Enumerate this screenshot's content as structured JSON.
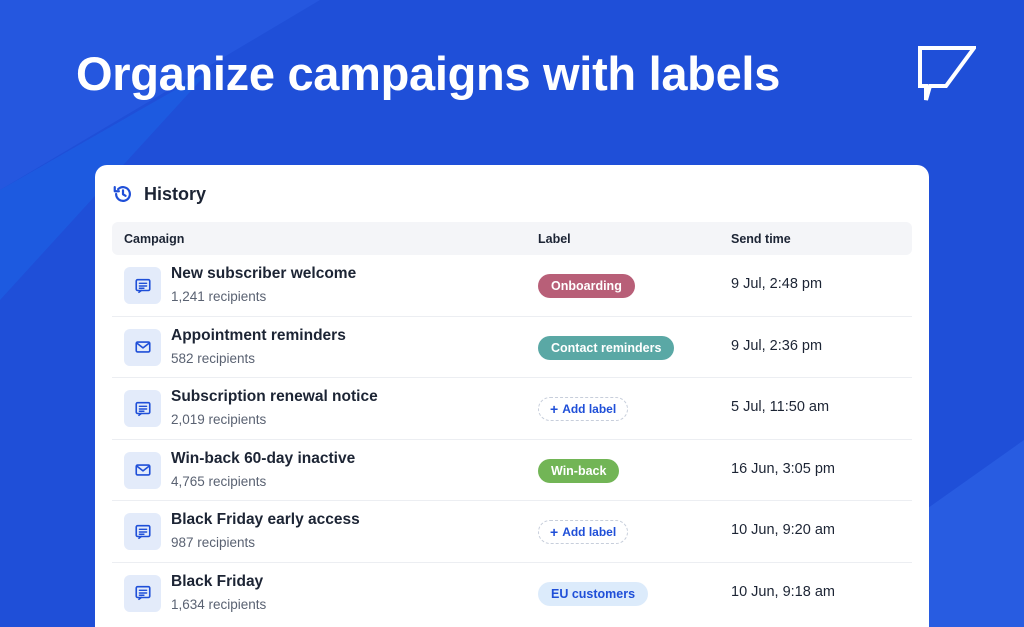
{
  "headline": "Organize campaigns with labels",
  "colors": {
    "background": "#1f4fd8",
    "accent": "#1f4fd8",
    "card": "#ffffff"
  },
  "history": {
    "title": "History",
    "icon": "history-icon",
    "columns": {
      "campaign": "Campaign",
      "label": "Label",
      "send_time": "Send time"
    },
    "rows": [
      {
        "icon": "message-icon",
        "title": "New subscriber welcome",
        "recipients": "1,241 recipients",
        "label": {
          "type": "tag",
          "text": "Onboarding",
          "color": "#b85f78"
        },
        "send_time": "9 Jul, 2:48 pm"
      },
      {
        "icon": "envelope-icon",
        "title": "Appointment reminders",
        "recipients": "582 recipients",
        "label": {
          "type": "tag",
          "text": "Contact reminders",
          "color": "#5aa8a5"
        },
        "send_time": "9 Jul, 2:36 pm"
      },
      {
        "icon": "message-icon",
        "title": "Subscription renewal notice",
        "recipients": "2,019 recipients",
        "label": {
          "type": "add",
          "text": "Add label"
        },
        "send_time": "5 Jul, 11:50 am"
      },
      {
        "icon": "envelope-icon",
        "title": "Win-back 60-day inactive",
        "recipients": "4,765 recipients",
        "label": {
          "type": "tag",
          "text": "Win-back",
          "color": "#72b556"
        },
        "send_time": "16 Jun, 3:05 pm"
      },
      {
        "icon": "message-icon",
        "title": "Black Friday early access",
        "recipients": "987 recipients",
        "label": {
          "type": "add",
          "text": "Add label"
        },
        "send_time": "10 Jun, 9:20 am"
      },
      {
        "icon": "message-icon",
        "title": "Black Friday",
        "recipients": "1,634 recipients",
        "label": {
          "type": "tag",
          "text": "EU customers",
          "color": "#dcebfb",
          "text_color": "#1f4fd8"
        },
        "send_time": "10 Jun, 9:18 am"
      }
    ]
  }
}
